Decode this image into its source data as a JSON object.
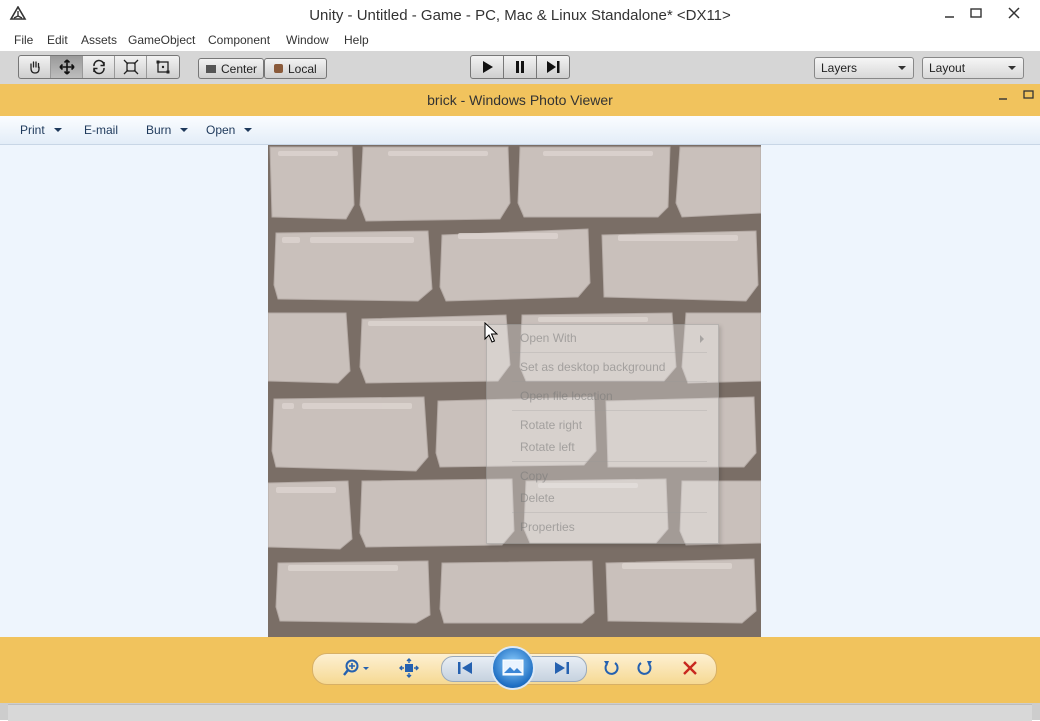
{
  "unity": {
    "title": "Unity - Untitled - Game - PC, Mac & Linux Standalone* <DX11>",
    "menu": [
      "File",
      "Edit",
      "Assets",
      "GameObject",
      "Component",
      "Window",
      "Help"
    ],
    "toolbar": {
      "tools": [
        "hand-icon",
        "move-icon",
        "rotate-icon",
        "scale-icon",
        "rect-tool-icon"
      ],
      "active_tool": "move-icon",
      "pivot_label": "Center",
      "space_label": "Local",
      "playback": [
        "play-icon",
        "pause-icon",
        "step-icon"
      ],
      "layers_label": "Layers",
      "layout_label": "Layout"
    }
  },
  "photo_viewer": {
    "title": "brick - Windows Photo Viewer",
    "menu": {
      "print": "Print",
      "email": "E-mail",
      "burn": "Burn",
      "open": "Open"
    },
    "image_name": "brick",
    "context_menu": {
      "open_with": "Open With",
      "set_desktop": "Set as desktop background",
      "open_location": "Open file location",
      "rotate_right": "Rotate right",
      "rotate_left": "Rotate left",
      "copy": "Copy",
      "delete": "Delete",
      "properties": "Properties"
    },
    "controls": [
      "zoom-icon",
      "fit-window-icon",
      "previous-icon",
      "slideshow-icon",
      "next-icon",
      "rotate-left-icon",
      "rotate-right-icon",
      "delete-icon"
    ]
  },
  "colors": {
    "pv_accent": "#f1c35d",
    "pv_background": "#eef5fd",
    "mortar": "#7a6e66",
    "brick": "#c9c0bb"
  }
}
